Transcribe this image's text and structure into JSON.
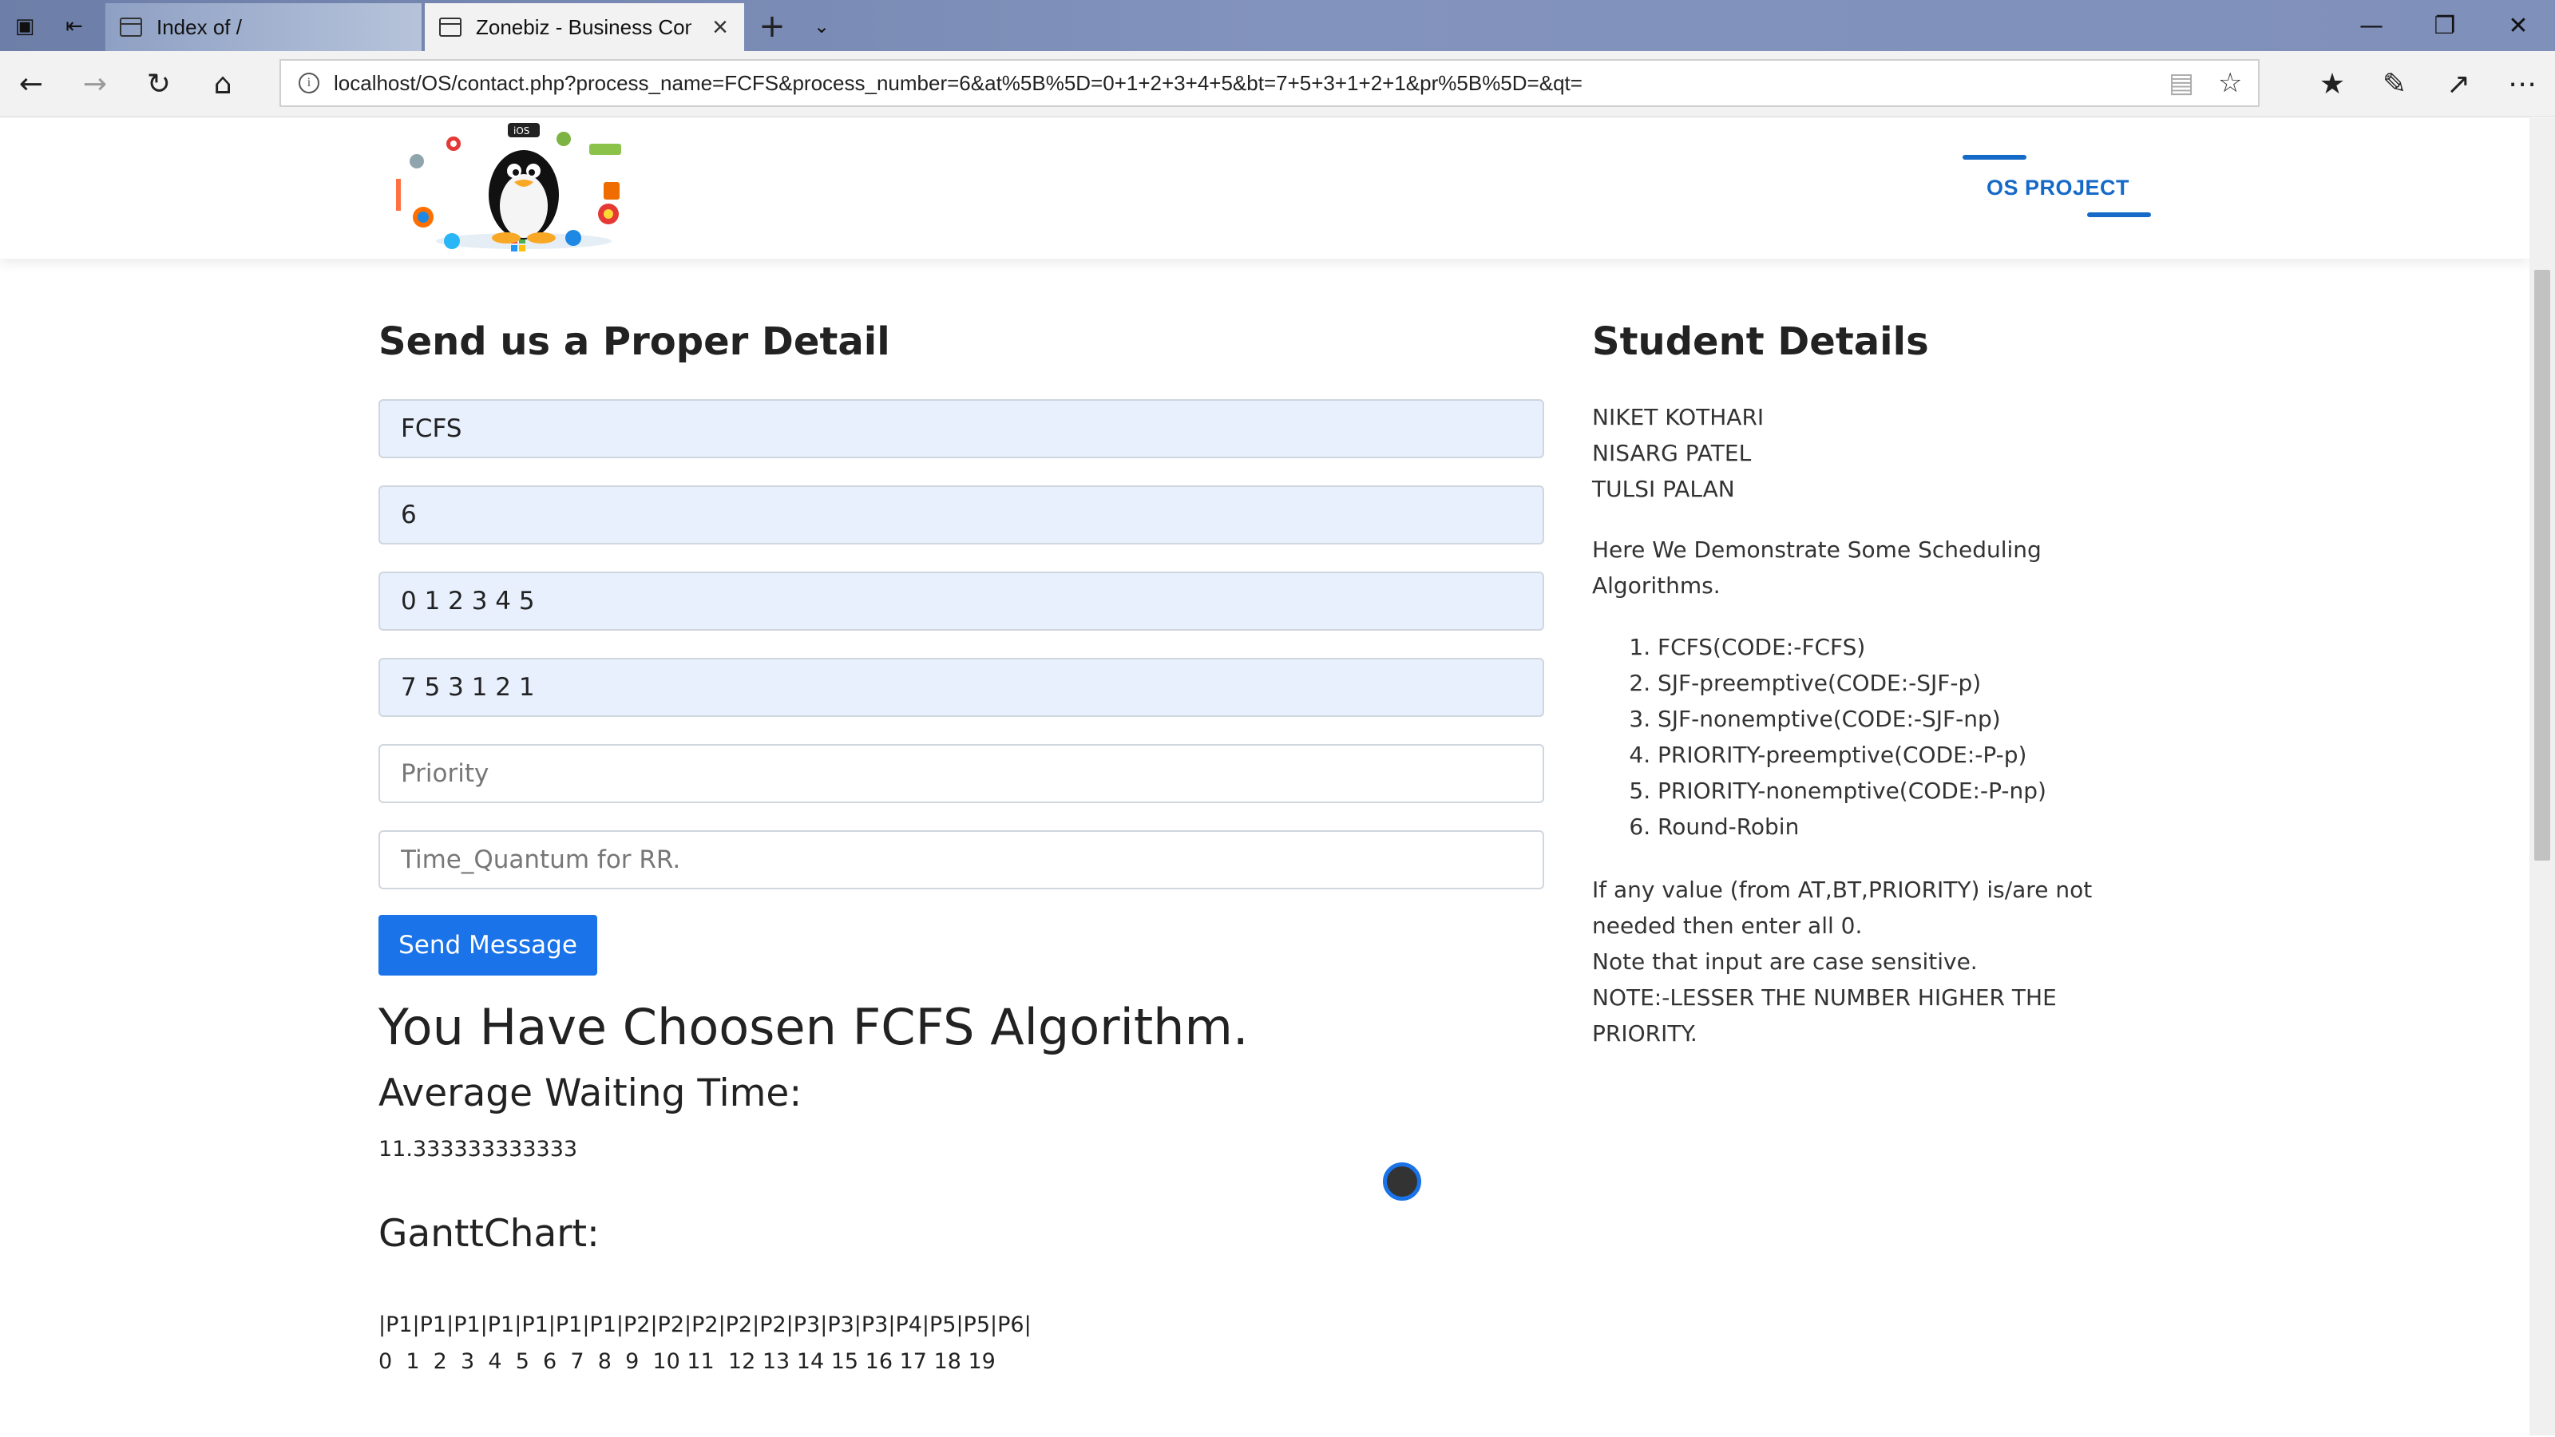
{
  "browser": {
    "tabs": [
      {
        "title": "Index of /",
        "active": false
      },
      {
        "title": "Zonebiz - Business Con:",
        "active": true
      }
    ],
    "url": "localhost/OS/contact.php?process_name=FCFS&process_number=6&at%5B%5D=0+1+2+3+4+5&bt=7+5+3+1+2+1&pr%5B%5D=&qt="
  },
  "header": {
    "logo_icon": "os-logos-with-tux",
    "nav_link": "OS PROJECT"
  },
  "form": {
    "title": "Send us a Proper Detail",
    "process_name": "FCFS",
    "process_number": "6",
    "arrival_times": "0 1 2 3 4 5",
    "burst_times": "7 5 3 1 2 1",
    "priority_placeholder": "Priority",
    "quantum_placeholder": "Time_Quantum for RR.",
    "submit_label": "Send Message"
  },
  "result": {
    "title": "You Have Choosen FCFS Algorithm.",
    "avg_label": "Average Waiting Time:",
    "avg_value": "11.333333333333",
    "gantt_label": "GanttChart:",
    "gantt_processes": "|P1|P1|P1|P1|P1|P1|P1|P2|P2|P2|P2|P2|P3|P3|P3|P4|P5|P5|P6|",
    "gantt_times": "0  1  2  3  4  5  6  7  8  9  10 11  12 13 14 15 16 17 18 19"
  },
  "side": {
    "title": "Student Details",
    "students": [
      "NIKET KOTHARI",
      "NISARG PATEL",
      "TULSI PALAN"
    ],
    "intro": "Here We Demonstrate Some Scheduling Algorithms.",
    "algorithms": [
      "FCFS(CODE:-FCFS)",
      "SJF-preemptive(CODE:-SJF-p)",
      "SJF-nonemptive(CODE:-SJF-np)",
      "PRIORITY-preemptive(CODE:-P-p)",
      "PRIORITY-nonemptive(CODE:-P-np)",
      "Round-Robin"
    ],
    "note1": "If any value (from AT,BT,PRIORITY) is/are not needed then enter all 0.",
    "note2": "Note that input are case sensitive.",
    "note3": "NOTE:-LESSER THE NUMBER HIGHER THE PRIORITY."
  },
  "colors": {
    "accent": "#1a73e8",
    "nav_link": "#1569c7",
    "filled_input": "#e8f0fe"
  }
}
